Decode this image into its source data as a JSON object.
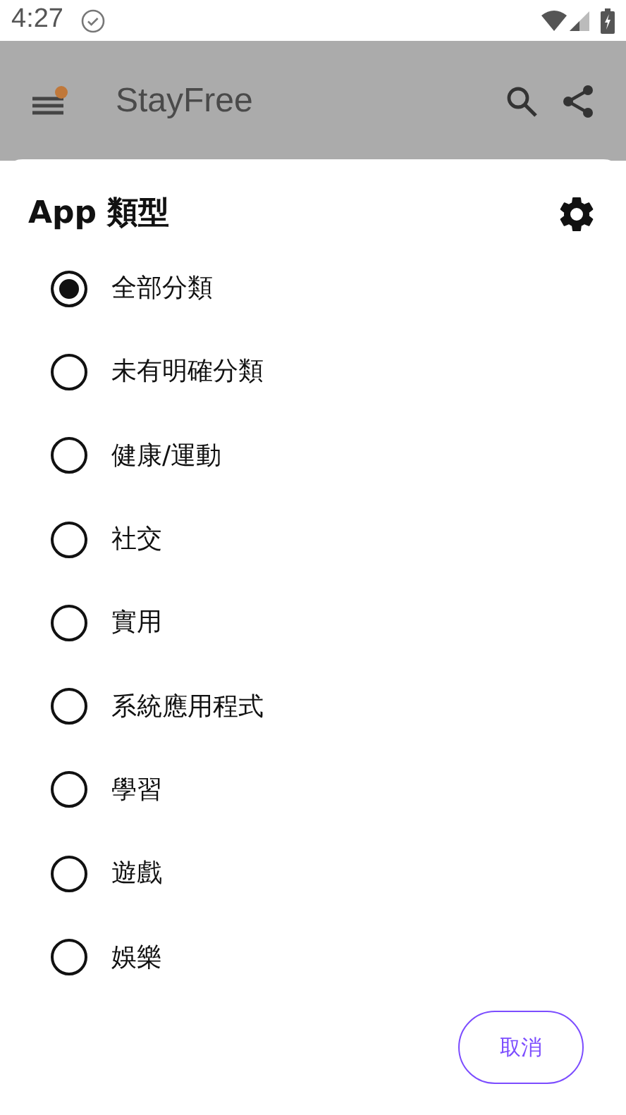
{
  "status_bar": {
    "time": "4:27"
  },
  "app_bar": {
    "title": "StayFree",
    "menu_badge": true
  },
  "dialog": {
    "title": "App 類型",
    "options": [
      {
        "label": "全部分類",
        "selected": true
      },
      {
        "label": "未有明確分類",
        "selected": false
      },
      {
        "label": "健康/運動",
        "selected": false
      },
      {
        "label": "社交",
        "selected": false
      },
      {
        "label": "實用",
        "selected": false
      },
      {
        "label": "系統應用程式",
        "selected": false
      },
      {
        "label": "學習",
        "selected": false
      },
      {
        "label": "遊戲",
        "selected": false
      },
      {
        "label": "娛樂",
        "selected": false
      }
    ],
    "buttons": [
      "取消"
    ]
  }
}
